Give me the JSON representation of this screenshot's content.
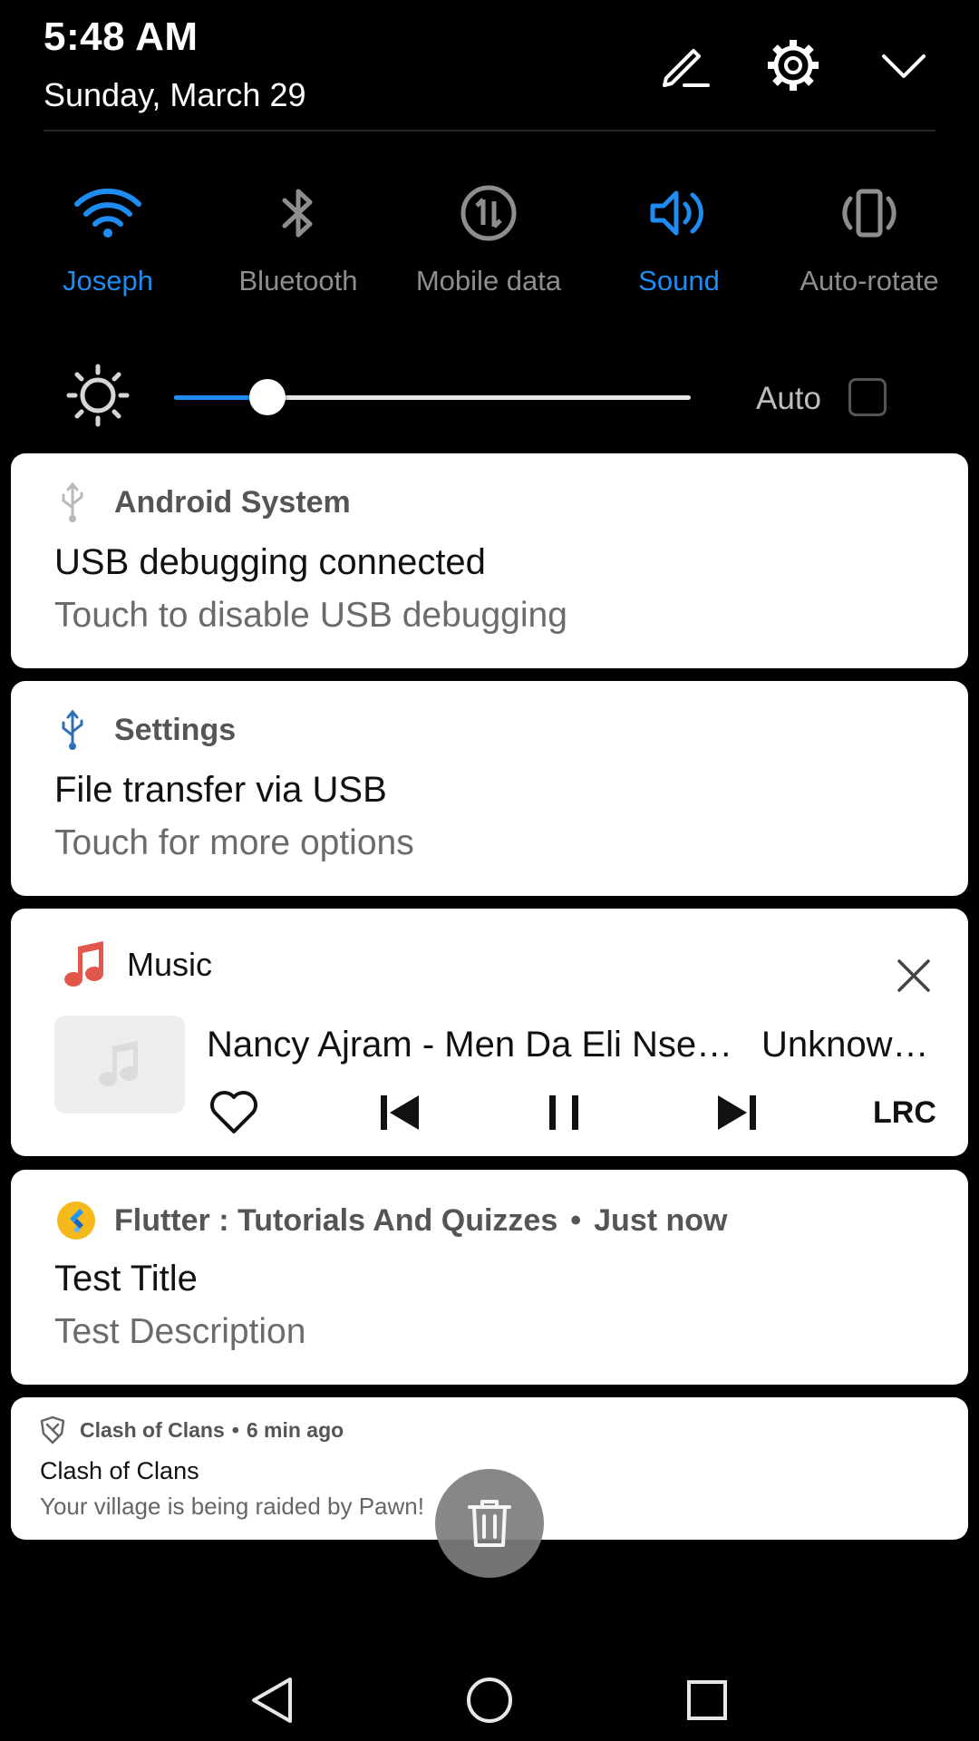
{
  "status": {
    "time": "5:48 AM",
    "date": "Sunday, March 29"
  },
  "quick_settings": [
    {
      "label": "Joseph",
      "icon": "wifi-icon",
      "active": true
    },
    {
      "label": "Bluetooth",
      "icon": "bluetooth-icon",
      "active": false
    },
    {
      "label": "Mobile data",
      "icon": "mobile-data-icon",
      "active": false
    },
    {
      "label": "Sound",
      "icon": "sound-icon",
      "active": true
    },
    {
      "label": "Auto-rotate",
      "icon": "auto-rotate-icon",
      "active": false
    }
  ],
  "brightness": {
    "level": 0.18,
    "auto_label": "Auto",
    "auto_checked": false
  },
  "notifications": {
    "usb_debug": {
      "app": "Android System",
      "title": "USB debugging connected",
      "text": "Touch to disable USB debugging",
      "icon": "usb-icon"
    },
    "file_transfer": {
      "app": "Settings",
      "title": "File transfer via USB",
      "text": "Touch for more options",
      "icon": "usb-icon"
    },
    "music": {
      "app": "Music",
      "track": "Nancy Ajram - Men Da Eli Nse…",
      "artist": "Unknow…",
      "lrc_label": "LRC",
      "icon": "music-note-icon"
    },
    "flutter": {
      "app": "Flutter : Tutorials And Quizzes",
      "time": "Just now",
      "title": "Test Title",
      "text": "Test Description",
      "icon": "flutter-logo-icon"
    },
    "coc": {
      "app": "Clash of Clans",
      "time": "6 min ago",
      "title": "Clash of Clans",
      "text": "Your village is being raided by Pawn!",
      "icon": "shield-icon"
    }
  },
  "separator": "•",
  "colors": {
    "accent": "#1e8cf0",
    "music": "#e2574c",
    "flutter_bg": "#f6b91b"
  }
}
